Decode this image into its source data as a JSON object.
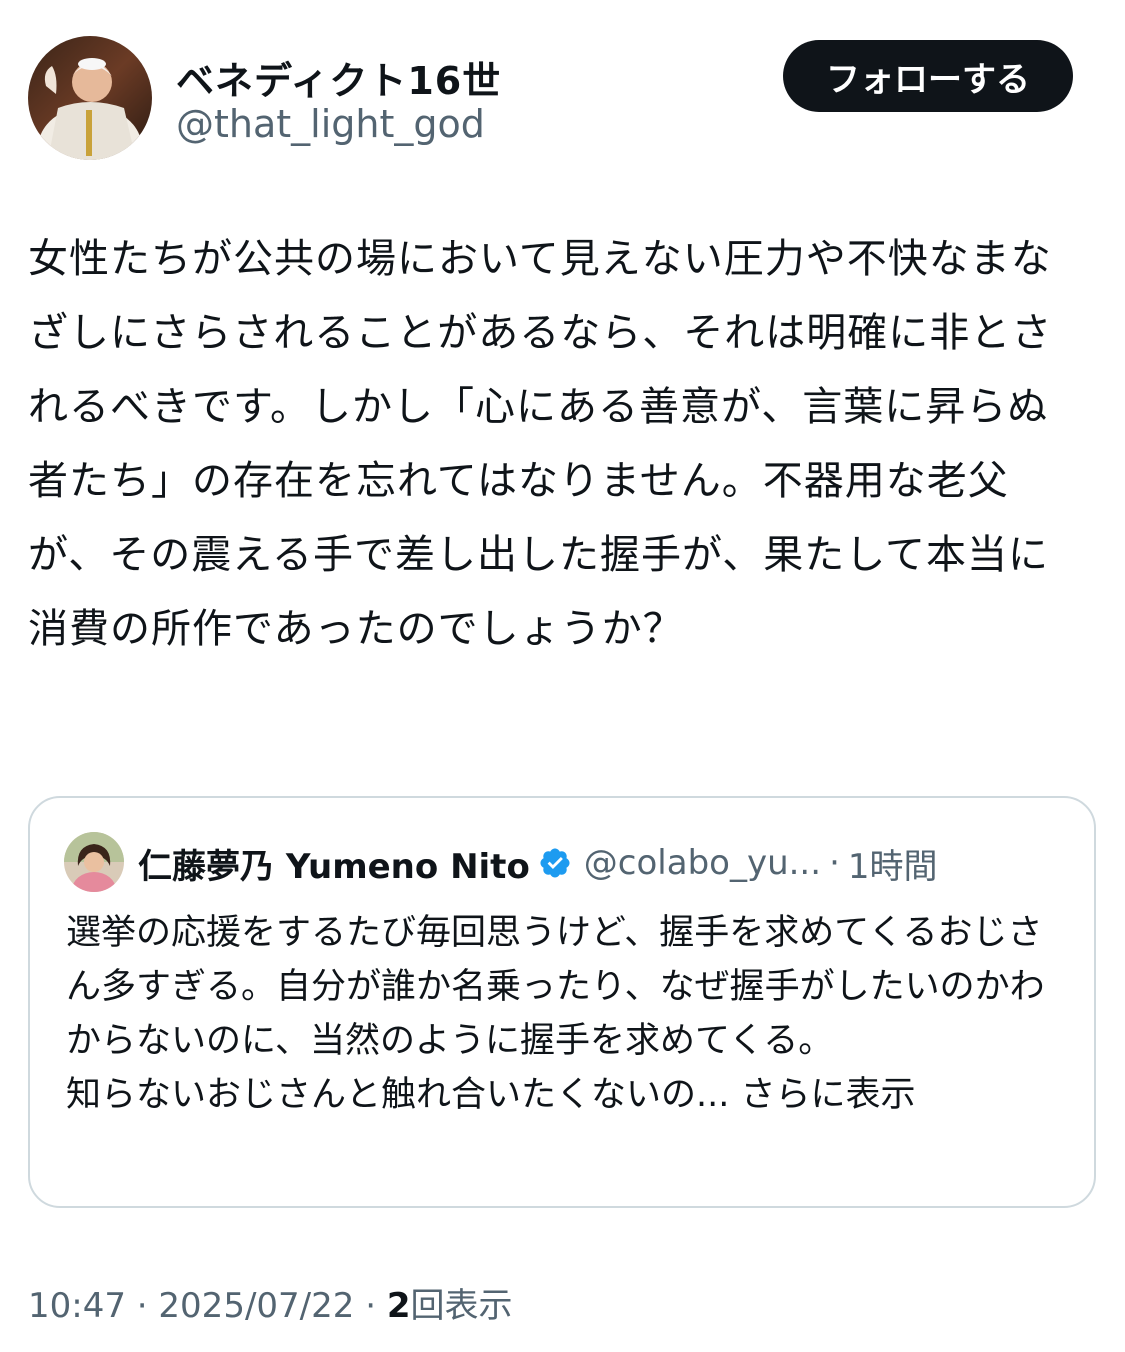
{
  "author": {
    "name": "ベネディクト16世",
    "handle": "@that_light_god",
    "follow_label": "フォローする"
  },
  "tweet": {
    "text": "女性たちが公共の場において見えない圧力や不快なまなざしにさらされることがあるなら、それは明確に非とされるべきです。しかし「心にある善意が、言葉に昇らぬ者たち」の存在を忘れてはなりません。不器用な老父が、その震える手で差し出した握手が、果たして本当に消費の所作であったのでしょうか？"
  },
  "quoted_tweet": {
    "name": "仁藤夢乃 Yumeno Nito",
    "handle": "@colabo_yu...",
    "separator": "·",
    "time": "1時間",
    "text": "選挙の応援をするたび毎回思うけど、握手を求めてくるおじさん多すぎる。自分が誰か名乗ったり、なぜ握手がしたいのかわからないのに、当然のように握手を求めてくる。\n知らないおじさんと触れ合いたくないの...",
    "show_more": "さらに表示",
    "verified_color": "#1d9bf0"
  },
  "meta": {
    "time": "10:47",
    "sep1": "·",
    "date": "2025/07/22",
    "sep2": "·",
    "views_count": "2",
    "views_label": "回表示"
  },
  "icons": {
    "author_avatar": "avatar-photo",
    "quoted_avatar": "avatar-photo",
    "verified": "verified-badge-icon"
  },
  "colors": {
    "text": "#0f1419",
    "secondary": "#536471",
    "border": "#cfd9de",
    "follow_bg": "#0f1419"
  }
}
